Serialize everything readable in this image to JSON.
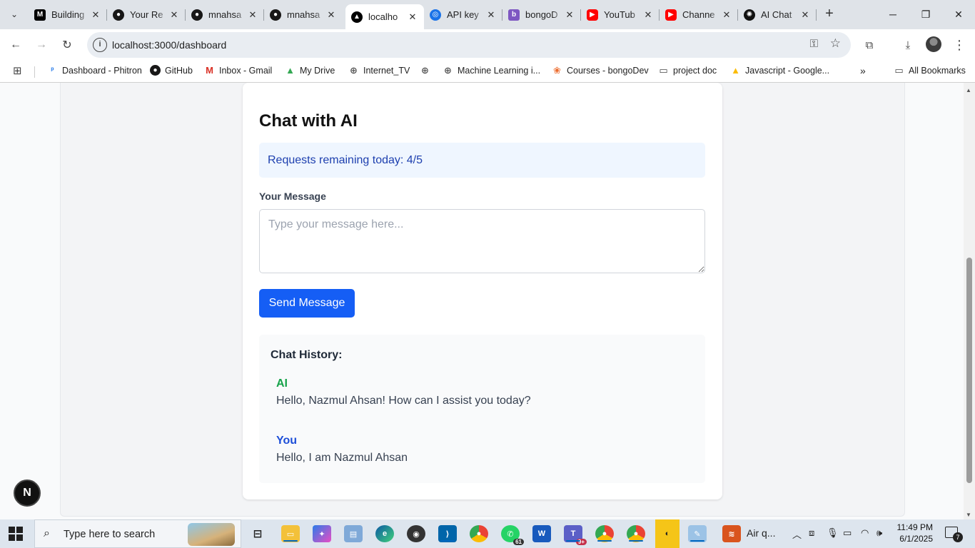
{
  "browser": {
    "tabs": [
      {
        "title": "Building",
        "icon": "medium-icon",
        "color": "#000000"
      },
      {
        "title": "Your Re",
        "icon": "github-icon",
        "color": "#181717"
      },
      {
        "title": "mnahsa",
        "icon": "github-icon",
        "color": "#181717"
      },
      {
        "title": "mnahsa",
        "icon": "github-icon",
        "color": "#181717"
      },
      {
        "title": "localho",
        "icon": "vercel-icon",
        "color": "#000000",
        "active": true
      },
      {
        "title": "API key",
        "icon": "openai-icon",
        "color": "#1a73e8"
      },
      {
        "title": "bongoD",
        "icon": "bongodev-icon",
        "color": "#7e57c2"
      },
      {
        "title": "YouTub",
        "icon": "youtube-icon",
        "color": "#ff0000"
      },
      {
        "title": "Channe",
        "icon": "youtube-icon",
        "color": "#ff0000"
      },
      {
        "title": "AI Chat",
        "icon": "chatgpt-icon",
        "color": "#111111"
      }
    ],
    "url": "localhost:3000/dashboard",
    "bookmarks": [
      {
        "label": "Dashboard - Phitron",
        "icon": "phitron-icon"
      },
      {
        "label": "GitHub",
        "icon": "github-icon"
      },
      {
        "label": "Inbox - Gmail",
        "icon": "gmail-icon"
      },
      {
        "label": "My Drive",
        "icon": "drive-icon"
      },
      {
        "label": "Internet_TV",
        "icon": "globe-icon"
      },
      {
        "label": "",
        "icon": "globe-icon"
      },
      {
        "label": "Machine Learning i...",
        "icon": "globe-icon"
      },
      {
        "label": "Courses - bongoDev",
        "icon": "bongodev-icon"
      },
      {
        "label": "project doc",
        "icon": "folder-icon"
      },
      {
        "label": "Javascript - Google...",
        "icon": "drive-icon"
      }
    ],
    "all_bookmarks": "All Bookmarks"
  },
  "page": {
    "title": "Chat with AI",
    "quota_text": "Requests remaining today: 4/5",
    "message_label": "Your Message",
    "message_placeholder": "Type your message here...",
    "message_value": "",
    "send_label": "Send Message",
    "history_title": "Chat History:",
    "history": [
      {
        "sender": "AI",
        "text": "Hello, Nazmul Ahsan! How can I assist you today?"
      },
      {
        "sender": "You",
        "text": "Hello, I am Nazmul Ahsan"
      }
    ],
    "next_badge": "N"
  },
  "taskbar": {
    "search_placeholder": "Type here to search",
    "airq_label": "Air q...",
    "whatsapp_badge": "61",
    "teams_badge": "9+",
    "time": "11:49 PM",
    "date": "6/1/2025",
    "notification_count": "7"
  }
}
